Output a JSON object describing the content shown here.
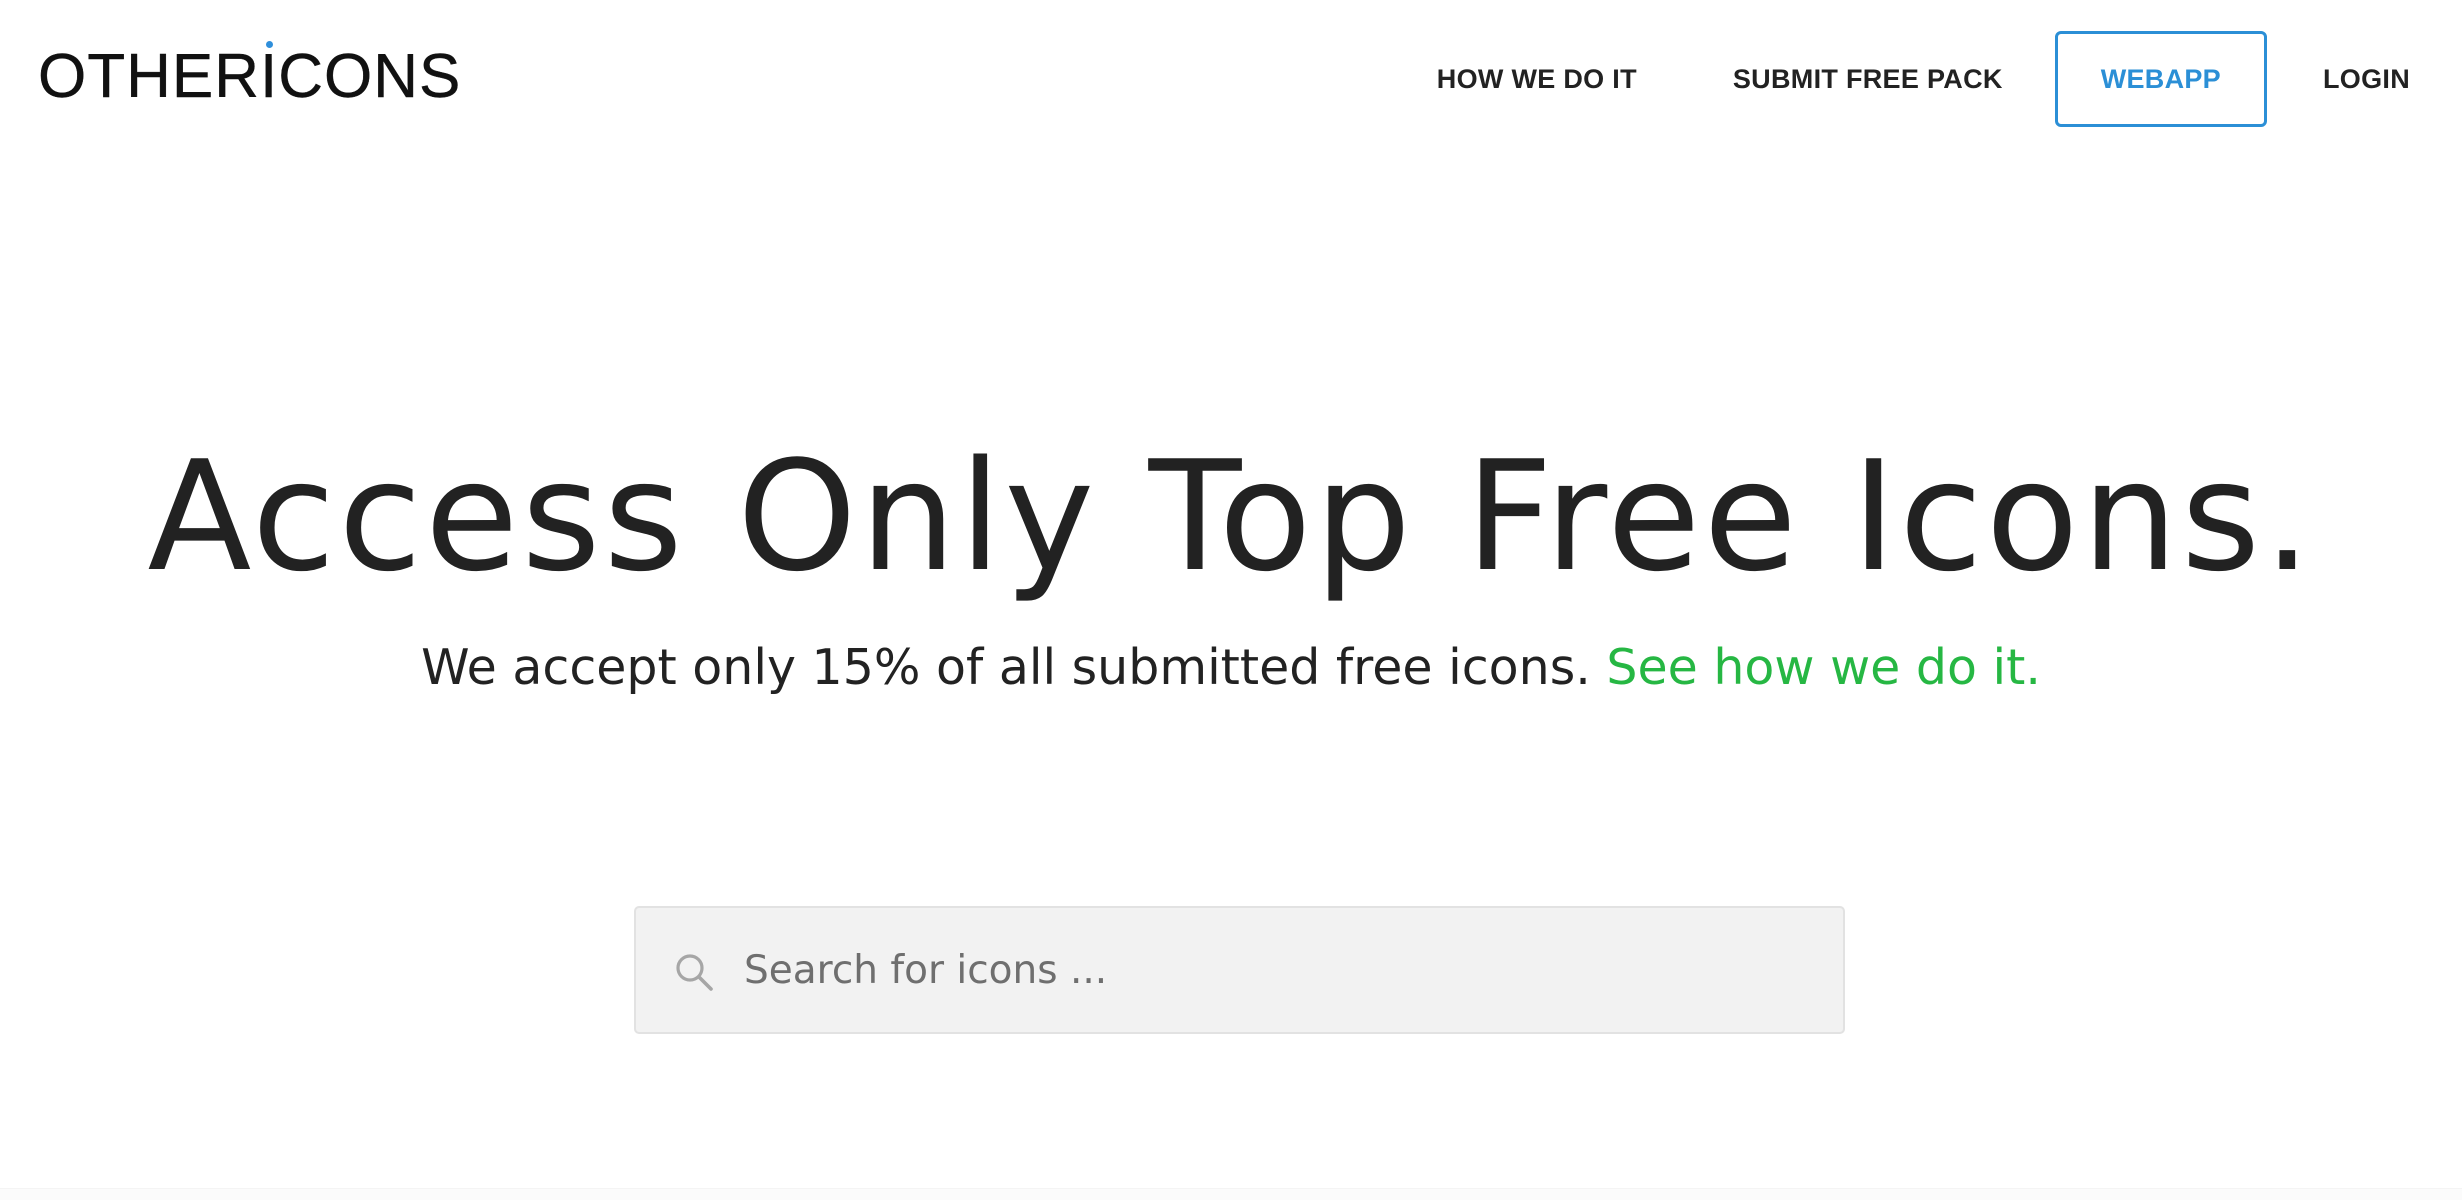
{
  "header": {
    "logo": {
      "prefix": "OTHER",
      "dotted_letter": "I",
      "suffix": "CONS"
    },
    "nav": {
      "how_we_do_it": "HOW WE DO IT",
      "submit_free_pack": "SUBMIT FREE PACK",
      "webapp": "WEBAPP",
      "login": "LOGIN"
    }
  },
  "hero": {
    "title": "Access Only Top Free Icons.",
    "subtitle": "We accept only 15% of all submitted free icons.",
    "subtitle_link": "See how we do it."
  },
  "search": {
    "placeholder": "Search for icons ...",
    "value": "",
    "icon": "search-icon"
  },
  "colors": {
    "accent_blue": "#2b8fd6",
    "link_green": "#26b743",
    "text": "#222222",
    "search_bg": "#f2f2f2"
  }
}
